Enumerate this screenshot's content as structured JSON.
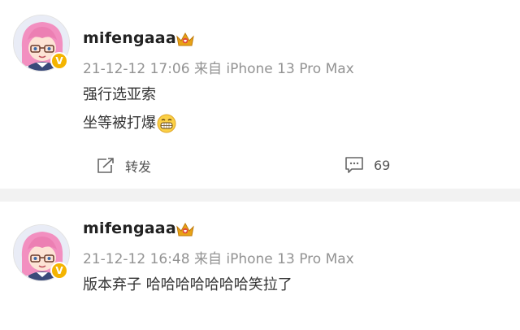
{
  "posts": [
    {
      "username": "mifengaaa",
      "timestamp": "21-12-12 17:06",
      "source": "来自 iPhone 13 Pro Max",
      "text_lines": [
        "强行选亚索",
        "坐等被打爆"
      ],
      "repost_label": "转发",
      "comment_count": "69",
      "icons": {
        "avatar": "anime-girl-avatar",
        "verified": "verified-badge-icon",
        "vip": "crown-icon",
        "emoji": "grin-emoji-icon"
      }
    },
    {
      "username": "mifengaaa",
      "timestamp": "21-12-12 16:48",
      "source": "来自 iPhone 13 Pro Max",
      "text_lines": [
        "版本弃子 哈哈哈哈哈哈哈笑拉了"
      ]
    }
  ],
  "colors": {
    "meta": "#939393",
    "badge": "#f4b400",
    "crown": "#e8a317",
    "divider": "#f2f2f2"
  }
}
